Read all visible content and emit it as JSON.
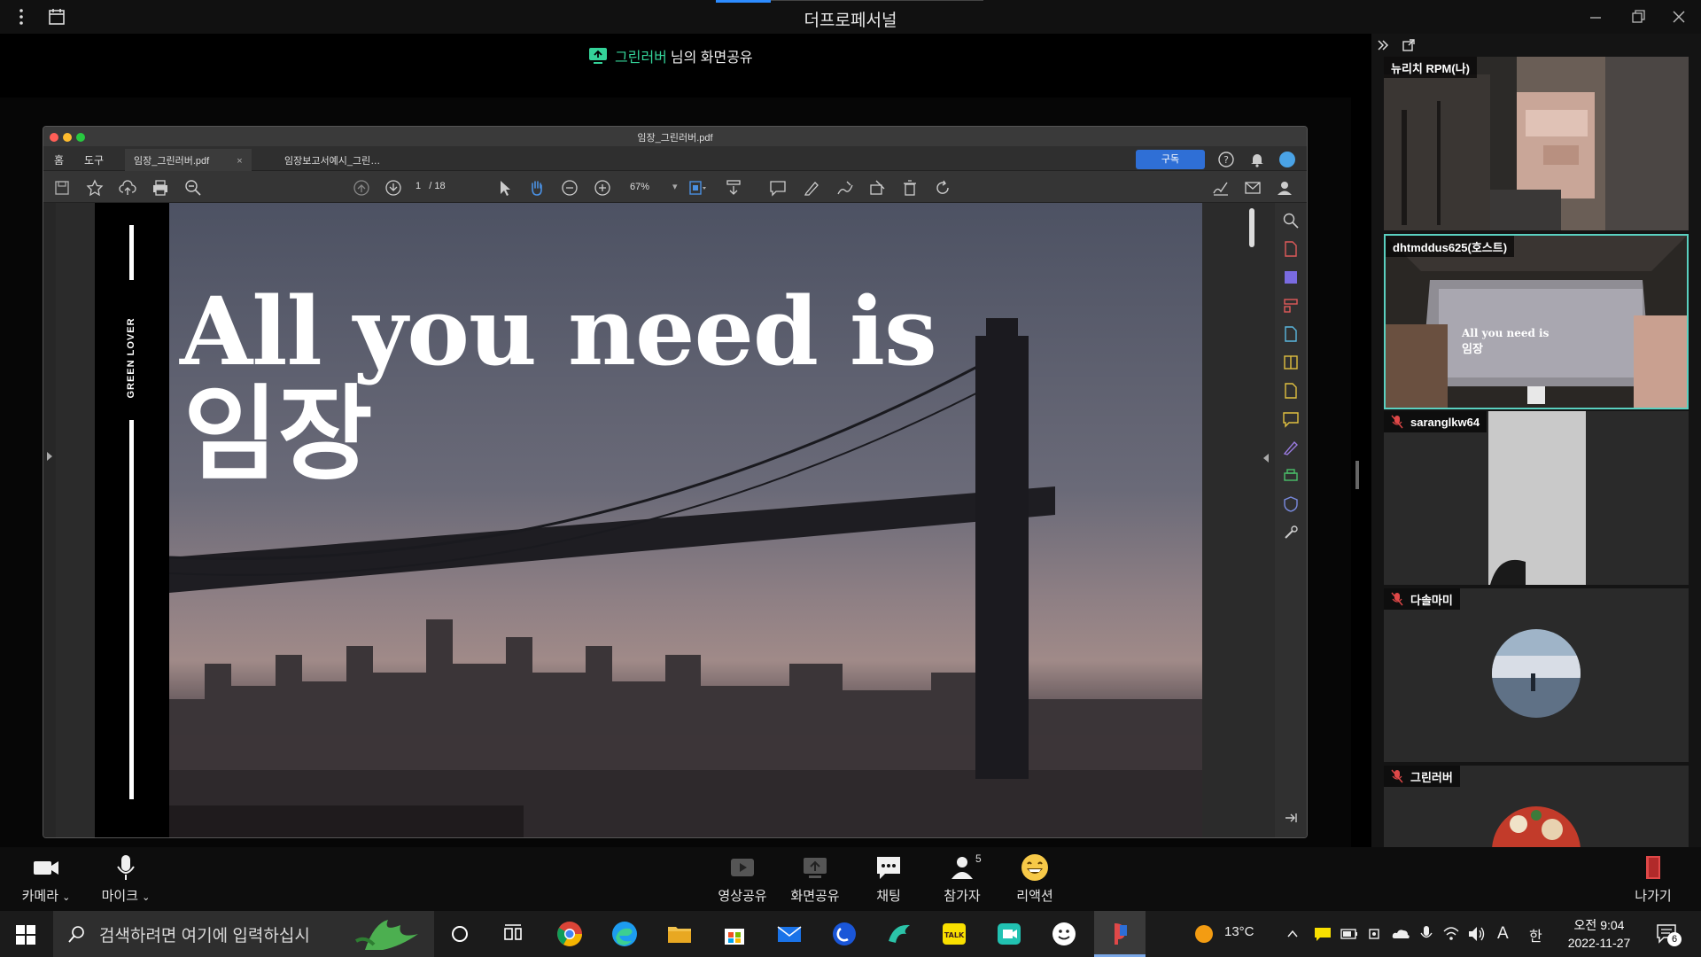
{
  "app": {
    "title": "더프로페서널"
  },
  "share_banner": {
    "presenter": "그린러버",
    "suffix": "님의 화면공유"
  },
  "pdf_app": {
    "window_title": "임장_그린러버.pdf",
    "menus": [
      "홈",
      "도구"
    ],
    "tabs": [
      {
        "label": "임장_그린러버.pdf",
        "close": "×"
      },
      {
        "label": "임장보고서예시_그린…"
      }
    ],
    "subscribe_label": "구독",
    "page_current": "1",
    "page_total": "/ 18",
    "zoom": "67%",
    "slide": {
      "side_label": "GREEN LOVER",
      "headline": "All you need is",
      "headline_ko": "임장"
    }
  },
  "participants": [
    {
      "name": "뉴리치 RPM(나)"
    },
    {
      "name": "dhtmddus625(호스트)",
      "active": true,
      "screen_line1": "All you need is",
      "screen_line2": "임장"
    },
    {
      "name": "saranglkw64",
      "muted": true
    },
    {
      "name": "다솔마미",
      "muted": true
    },
    {
      "name": "그린러버",
      "muted": true
    }
  ],
  "meeting_controls": {
    "camera": "카메라",
    "mic": "마이크",
    "video_share": "영상공유",
    "screen_share": "화면공유",
    "chat": "채팅",
    "participants": "참가자",
    "participants_count": "5",
    "reactions": "리액션",
    "leave": "나가기"
  },
  "taskbar": {
    "search_placeholder": "검색하려면 여기에 입력하십시",
    "weather": "13°C",
    "ime_a": "A",
    "ime_han": "한",
    "time": "오전 9:04",
    "date": "2022-11-27",
    "notif_count": "6"
  }
}
